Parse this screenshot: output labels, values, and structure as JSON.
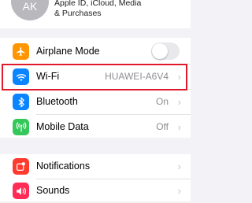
{
  "profile": {
    "initials": "AK",
    "subtitle_line1": "Apple ID, iCloud, Media",
    "subtitle_line2": "& Purchases"
  },
  "settings": {
    "airplane_mode": {
      "label": "Airplane Mode",
      "icon": "airplane-icon",
      "color": "#ff9500",
      "enabled": false
    },
    "wifi": {
      "label": "Wi-Fi",
      "value": "HUAWEI-A6V4",
      "icon": "wifi-icon",
      "color": "#0a84ff"
    },
    "bluetooth": {
      "label": "Bluetooth",
      "value": "On",
      "icon": "bluetooth-icon",
      "color": "#0a84ff"
    },
    "mobile_data": {
      "label": "Mobile Data",
      "value": "Off",
      "icon": "antenna-icon",
      "color": "#34c759"
    },
    "notifications": {
      "label": "Notifications",
      "icon": "notifications-icon",
      "color": "#ff3b30"
    },
    "sounds": {
      "label": "Sounds",
      "icon": "speaker-icon",
      "color": "#ff2d55"
    }
  },
  "highlight_color": "#e0192b"
}
